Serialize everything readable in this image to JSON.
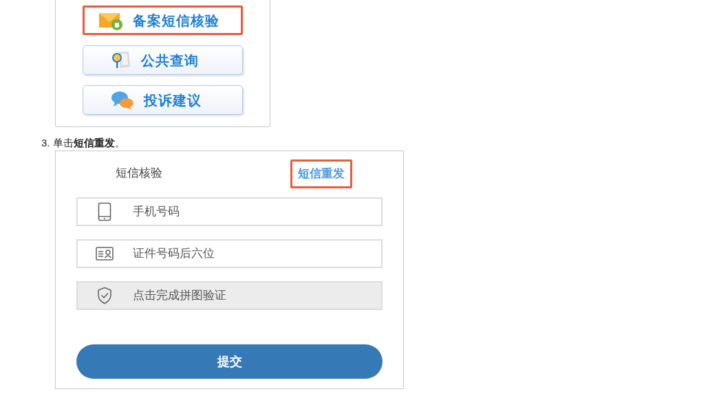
{
  "figure_1": {
    "buttons": [
      {
        "label": "备案短信核验",
        "kind": "envelope",
        "highlighted": true
      },
      {
        "label": "公共查询",
        "kind": "search",
        "highlighted": false
      },
      {
        "label": "投诉建议",
        "kind": "chat",
        "highlighted": false
      }
    ]
  },
  "step": {
    "text": "3. 单击**短信重发**。"
  },
  "figure_2": {
    "title": "短信核验",
    "resend_link": {
      "label": "短信重发",
      "highlighted": true
    },
    "fields": [
      {
        "kind": "phone",
        "placeholder": "手机号码"
      },
      {
        "kind": "id_card",
        "placeholder": "证件号码后六位"
      },
      {
        "kind": "captcha",
        "placeholder": "点击完成拼图验证"
      }
    ],
    "submit": {
      "label": "提交"
    }
  }
}
